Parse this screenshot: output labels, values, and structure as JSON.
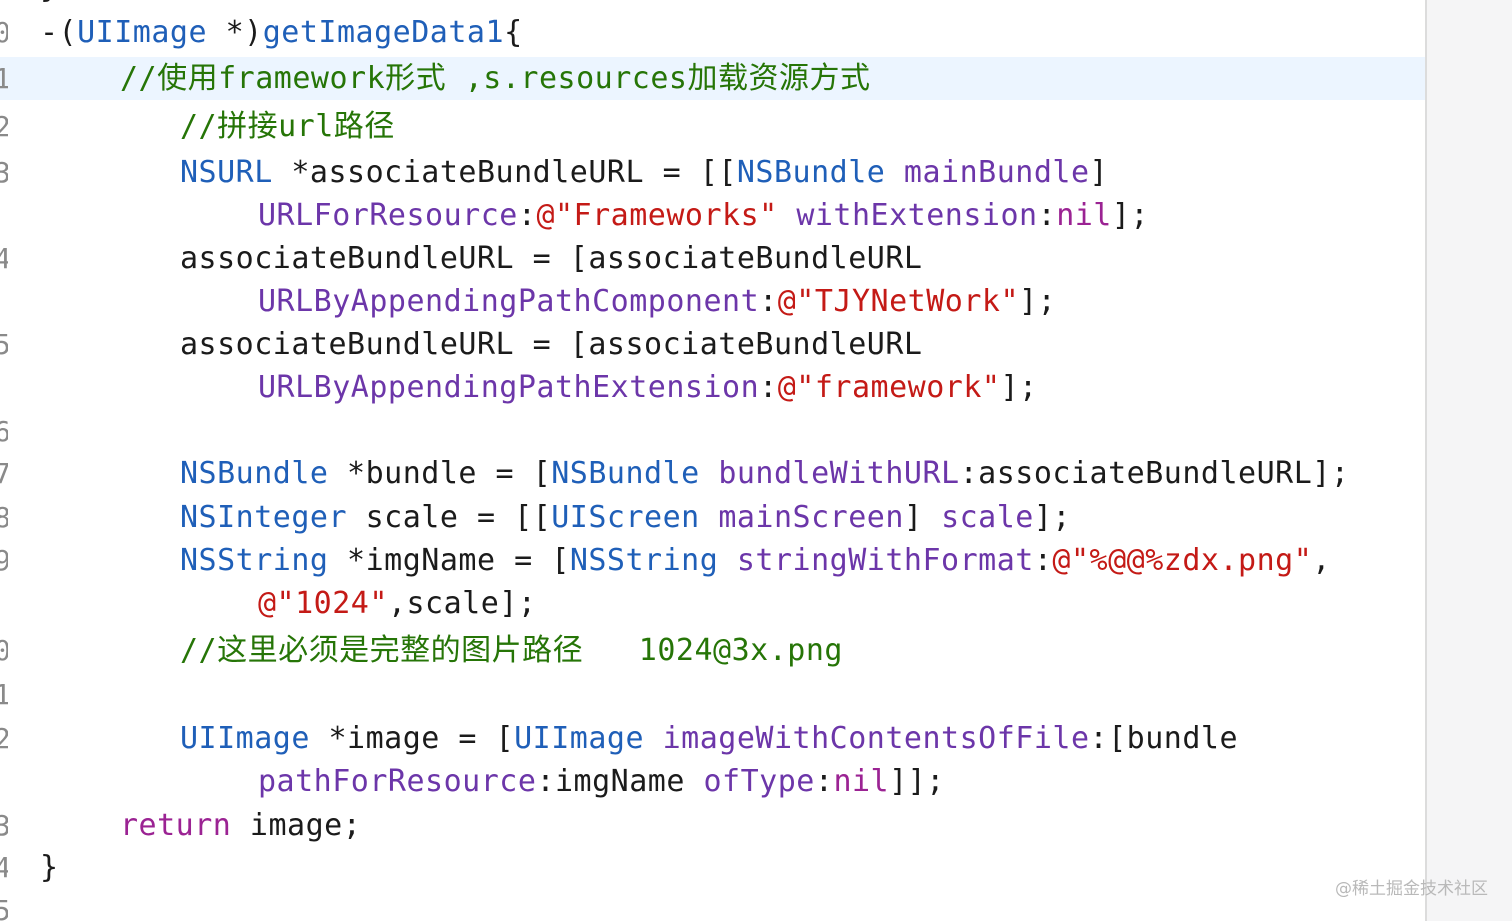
{
  "editor": {
    "lines": [
      {
        "num": "0",
        "tokens": [
          {
            "t": "-(",
            "c": "plain"
          },
          {
            "t": "UIImage",
            "c": "cls"
          },
          {
            "t": " *)",
            "c": "plain"
          },
          {
            "t": "getImageData1",
            "c": "cls"
          },
          {
            "t": "{",
            "c": "plain"
          }
        ]
      },
      {
        "num": "1",
        "tokens": [
          {
            "t": "//使用framework形式 ,s.resources加载资源方式",
            "c": "com"
          }
        ]
      },
      {
        "num": "2",
        "tokens": [
          {
            "t": "//拼接url路径",
            "c": "com"
          }
        ]
      },
      {
        "num": "3",
        "tokens": [
          {
            "t": "NSURL",
            "c": "cls"
          },
          {
            "t": " *associateBundleURL = [[",
            "c": "plain"
          },
          {
            "t": "NSBundle",
            "c": "cls"
          },
          {
            "t": " ",
            "c": "plain"
          },
          {
            "t": "mainBundle",
            "c": "method"
          },
          {
            "t": "]",
            "c": "plain"
          }
        ]
      },
      {
        "num": "",
        "tokens": [
          {
            "t": "URLForResource",
            "c": "method"
          },
          {
            "t": ":",
            "c": "plain"
          },
          {
            "t": "@\"Frameworks\"",
            "c": "str"
          },
          {
            "t": " ",
            "c": "plain"
          },
          {
            "t": "withExtension",
            "c": "method"
          },
          {
            "t": ":",
            "c": "plain"
          },
          {
            "t": "nil",
            "c": "kw"
          },
          {
            "t": "];",
            "c": "plain"
          }
        ]
      },
      {
        "num": "4",
        "tokens": [
          {
            "t": "associateBundleURL = [associateBundleURL",
            "c": "plain"
          }
        ]
      },
      {
        "num": "",
        "tokens": [
          {
            "t": "URLByAppendingPathComponent",
            "c": "method"
          },
          {
            "t": ":",
            "c": "plain"
          },
          {
            "t": "@\"TJYNetWork\"",
            "c": "str"
          },
          {
            "t": "];",
            "c": "plain"
          }
        ]
      },
      {
        "num": "5",
        "tokens": [
          {
            "t": "associateBundleURL = [associateBundleURL",
            "c": "plain"
          }
        ]
      },
      {
        "num": "",
        "tokens": [
          {
            "t": "URLByAppendingPathExtension",
            "c": "method"
          },
          {
            "t": ":",
            "c": "plain"
          },
          {
            "t": "@\"framework\"",
            "c": "str"
          },
          {
            "t": "];",
            "c": "plain"
          }
        ]
      },
      {
        "num": "6",
        "tokens": []
      },
      {
        "num": "7",
        "tokens": [
          {
            "t": "NSBundle",
            "c": "cls"
          },
          {
            "t": " *bundle = [",
            "c": "plain"
          },
          {
            "t": "NSBundle",
            "c": "cls"
          },
          {
            "t": " ",
            "c": "plain"
          },
          {
            "t": "bundleWithURL",
            "c": "method"
          },
          {
            "t": ":associateBundleURL];",
            "c": "plain"
          }
        ]
      },
      {
        "num": "8",
        "tokens": [
          {
            "t": "NSInteger",
            "c": "cls"
          },
          {
            "t": " scale = [[",
            "c": "plain"
          },
          {
            "t": "UIScreen",
            "c": "cls"
          },
          {
            "t": " ",
            "c": "plain"
          },
          {
            "t": "mainScreen",
            "c": "method"
          },
          {
            "t": "] ",
            "c": "plain"
          },
          {
            "t": "scale",
            "c": "method"
          },
          {
            "t": "];",
            "c": "plain"
          }
        ]
      },
      {
        "num": "9",
        "tokens": [
          {
            "t": "NSString",
            "c": "cls"
          },
          {
            "t": " *imgName = [",
            "c": "plain"
          },
          {
            "t": "NSString",
            "c": "cls"
          },
          {
            "t": " ",
            "c": "plain"
          },
          {
            "t": "stringWithFormat",
            "c": "method"
          },
          {
            "t": ":",
            "c": "plain"
          },
          {
            "t": "@\"%@@%zdx.png\"",
            "c": "str"
          },
          {
            "t": ",",
            "c": "plain"
          }
        ]
      },
      {
        "num": "",
        "tokens": [
          {
            "t": "@\"1024\"",
            "c": "str"
          },
          {
            "t": ",scale];",
            "c": "plain"
          }
        ]
      },
      {
        "num": "0",
        "tokens": [
          {
            "t": "//这里必须是完整的图片路径   1024@3x.png",
            "c": "com"
          }
        ]
      },
      {
        "num": "1",
        "tokens": []
      },
      {
        "num": "2",
        "tokens": [
          {
            "t": "UIImage",
            "c": "cls"
          },
          {
            "t": " *image = [",
            "c": "plain"
          },
          {
            "t": "UIImage",
            "c": "cls"
          },
          {
            "t": " ",
            "c": "plain"
          },
          {
            "t": "imageWithContentsOfFile",
            "c": "method"
          },
          {
            "t": ":[bundle",
            "c": "plain"
          }
        ]
      },
      {
        "num": "",
        "tokens": [
          {
            "t": "pathForResource",
            "c": "method"
          },
          {
            "t": ":imgName ",
            "c": "plain"
          },
          {
            "t": "ofType",
            "c": "method"
          },
          {
            "t": ":",
            "c": "plain"
          },
          {
            "t": "nil",
            "c": "kw"
          },
          {
            "t": "]];",
            "c": "plain"
          }
        ]
      },
      {
        "num": "3",
        "tokens": [
          {
            "t": "return",
            "c": "kw"
          },
          {
            "t": " image;",
            "c": "plain"
          }
        ]
      },
      {
        "num": "4",
        "tokens": [
          {
            "t": "}",
            "c": "plain"
          }
        ]
      },
      {
        "num": "5",
        "tokens": []
      }
    ]
  },
  "watermark": "@稀土掘金技术社区"
}
